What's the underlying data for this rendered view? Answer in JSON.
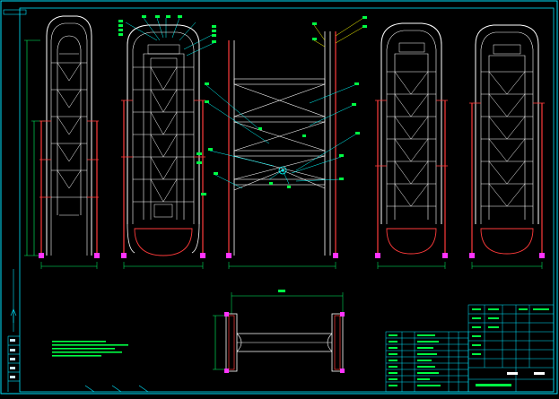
{
  "drawing": {
    "corner_tag": "",
    "notes_heading": "",
    "notes_lines": [],
    "title_block": {
      "rows": []
    }
  },
  "colors": {
    "background": "#000000",
    "frame": "#00e5ff",
    "structure_white": "#ffffff",
    "dimension_green": "#00ff66",
    "leader_cyan": "#00ffff",
    "accent_red": "#ff3b3b",
    "foot_magenta": "#ff33ff",
    "label_green": "#00ff44",
    "leader_yellow": "#ffff00"
  },
  "icons": {
    "callout_marker": "filled-dot",
    "hinge_marker": "small-circle"
  }
}
